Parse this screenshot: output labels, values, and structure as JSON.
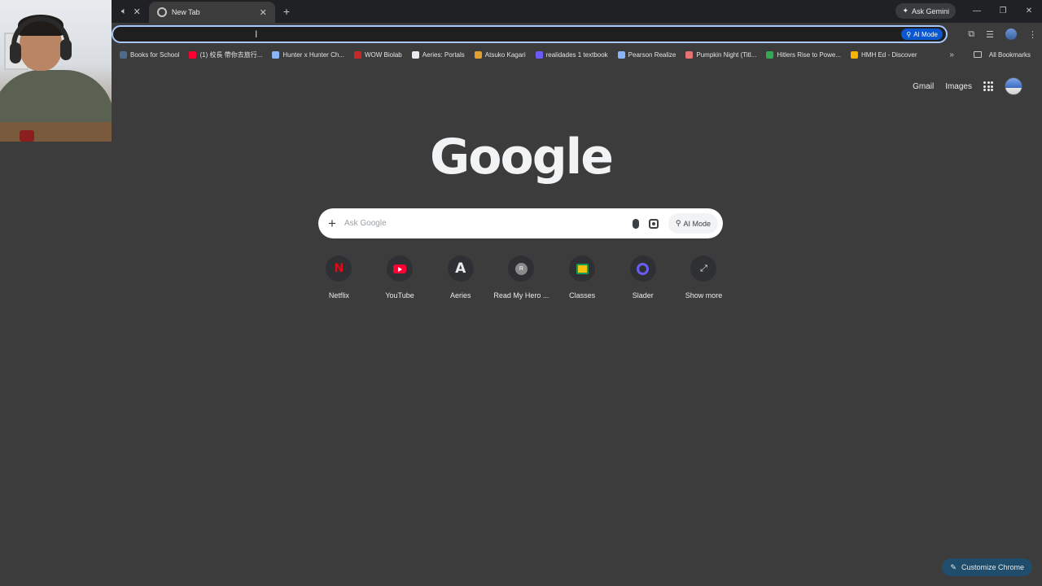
{
  "tabs": [
    {
      "label": "New Tab"
    }
  ],
  "gemini_label": "Ask Gemini",
  "omnibox": {
    "ai_mode_label": "AI Mode"
  },
  "bookmarks": [
    {
      "label": "Books for School",
      "icon_color": "#4f6b8a"
    },
    {
      "label": "(1) 校長 帶你去旅行...",
      "icon_color": "#ff0033"
    },
    {
      "label": "Hunter x Hunter Ch...",
      "icon_color": "#8ab4f8"
    },
    {
      "label": "WOW Biolab",
      "icon_color": "#c62828"
    },
    {
      "label": "Aeries: Portals",
      "icon_color": "#e8eaed"
    },
    {
      "label": "Atsuko Kagari",
      "icon_color": "#e0a030"
    },
    {
      "label": "realidades 1 textbook",
      "icon_color": "#6a5cf5"
    },
    {
      "label": "Pearson Realize",
      "icon_color": "#8ab4f8"
    },
    {
      "label": "Pumpkin Night (Titl...",
      "icon_color": "#e57373"
    },
    {
      "label": "Hitlers Rise to Powe...",
      "icon_color": "#34a853"
    },
    {
      "label": "HMH Ed - Discover",
      "icon_color": "#f4b400"
    }
  ],
  "all_bookmarks_label": "All Bookmarks",
  "header_links": {
    "gmail": "Gmail",
    "images": "Images"
  },
  "logo_text": "Google",
  "search": {
    "placeholder": "Ask Google",
    "ai_mode_label": "AI Mode"
  },
  "shortcuts": [
    {
      "label": "Netflix",
      "icon": "netflix-icon"
    },
    {
      "label": "YouTube",
      "icon": "youtube-icon"
    },
    {
      "label": "Aeries",
      "icon": "aeries-icon"
    },
    {
      "label": "Read My Hero ...",
      "icon": "r-letter-icon"
    },
    {
      "label": "Classes",
      "icon": "classroom-icon"
    },
    {
      "label": "Slader",
      "icon": "slader-icon"
    },
    {
      "label": "Show more",
      "icon": "expand-icon"
    }
  ],
  "customize_label": "Customize Chrome"
}
